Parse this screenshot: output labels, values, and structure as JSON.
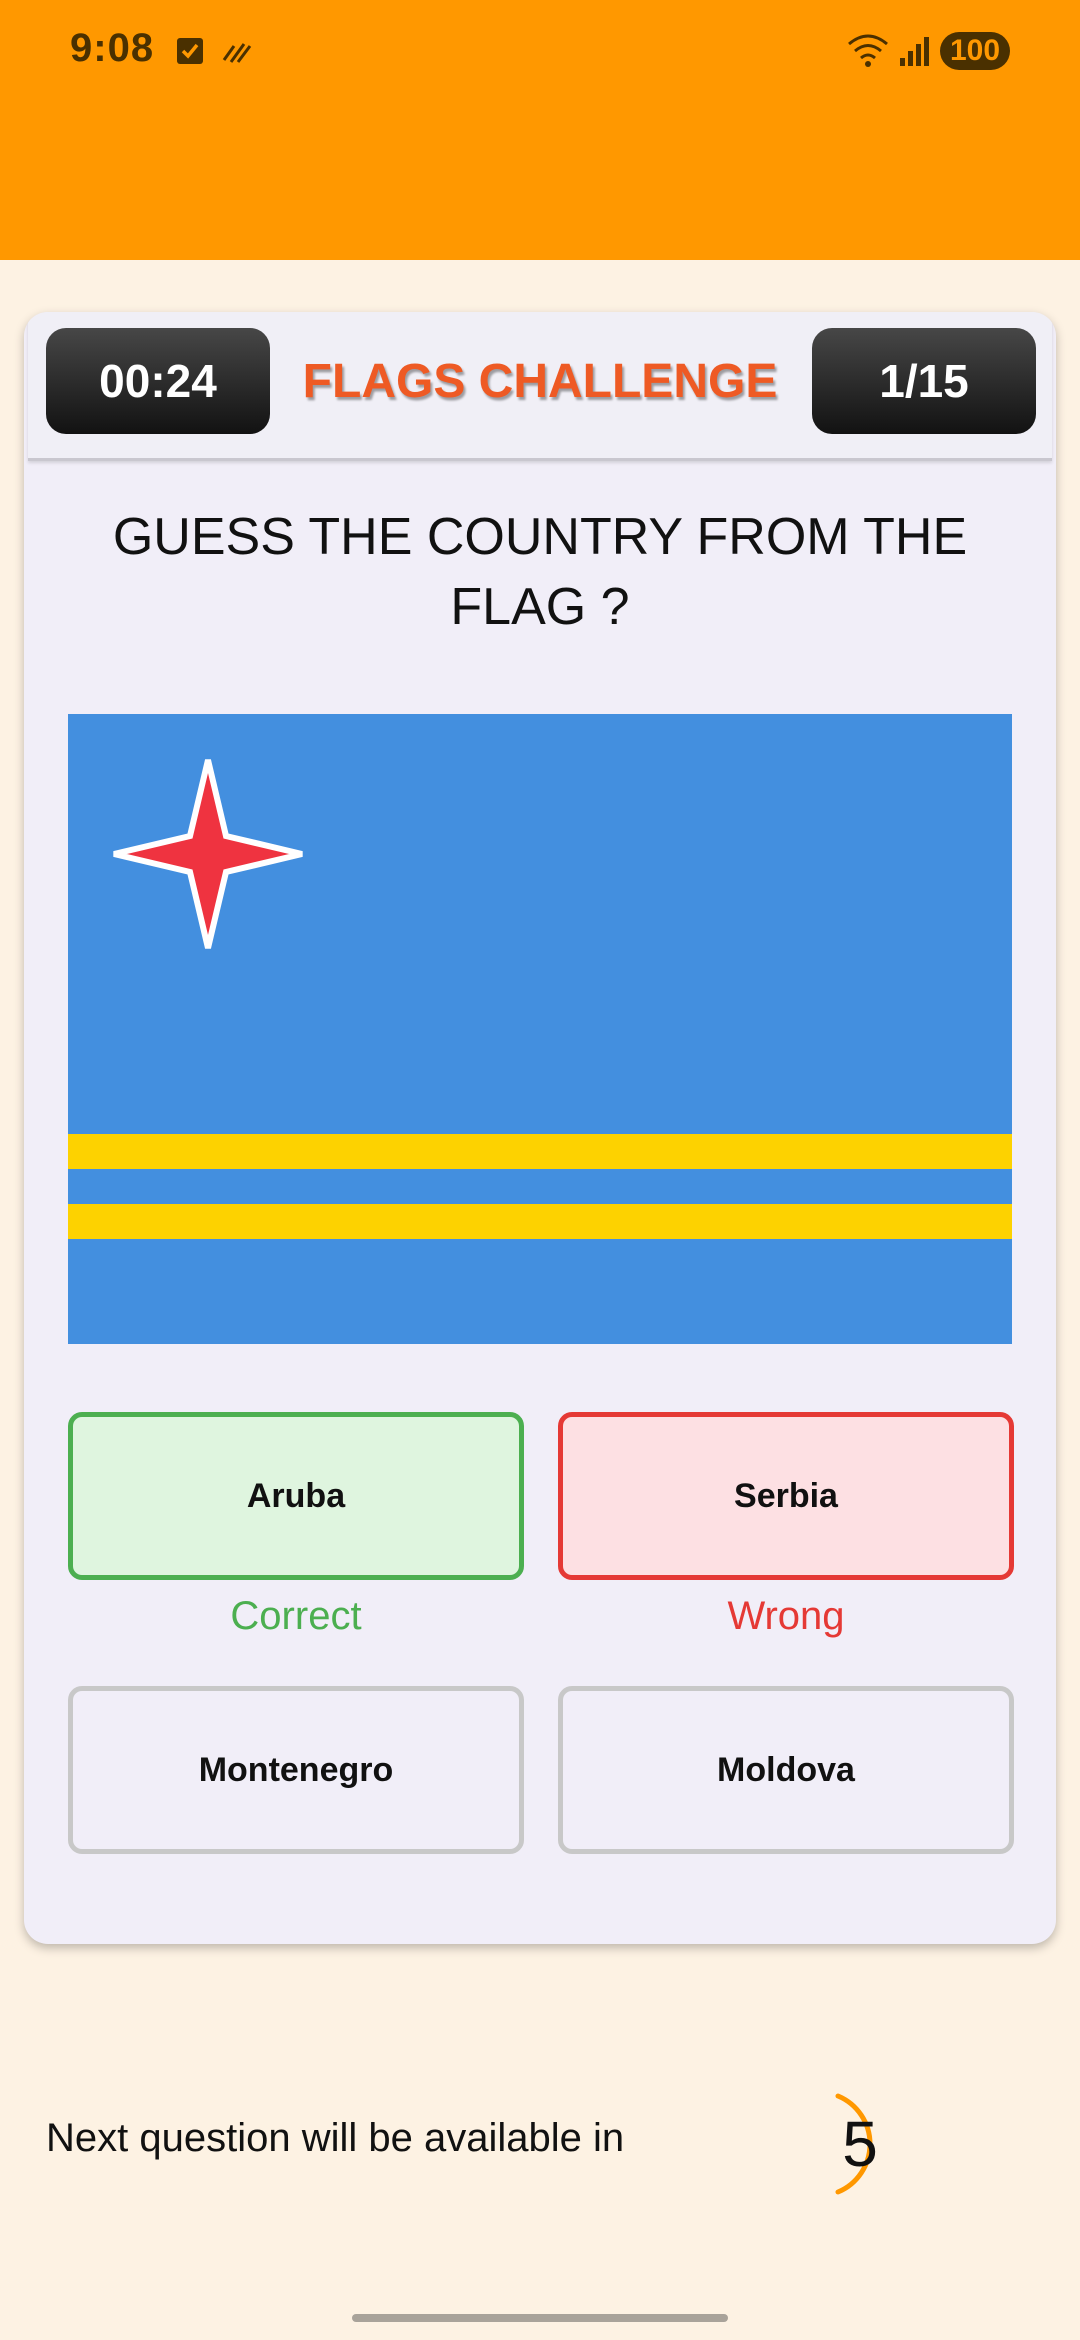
{
  "status_bar": {
    "time": "9:08",
    "battery": "100"
  },
  "header": {
    "timer": "00:24",
    "title": "FLAGS CHALLENGE",
    "progress": "1/15"
  },
  "question": "GUESS THE COUNTRY FROM THE FLAG ?",
  "flag": {
    "colors": {
      "field": "#438fdf",
      "stripe": "#fdd200",
      "star": "#ef3340",
      "star_outline": "#ffffff"
    }
  },
  "options": [
    {
      "label": "Aruba",
      "state": "correct"
    },
    {
      "label": "Serbia",
      "state": "wrong"
    },
    {
      "label": "Montenegro",
      "state": "neutral"
    },
    {
      "label": "Moldova",
      "state": "neutral"
    }
  ],
  "feedback": {
    "correct": "Correct",
    "wrong": "Wrong"
  },
  "next": {
    "text": "Next question will be available in",
    "countdown": "5"
  },
  "colors": {
    "accent": "#ff9800",
    "title": "#ee5a24",
    "correct": "#4caf50",
    "wrong": "#e53935",
    "background": "#fdf2e3",
    "card": "#f1eef8"
  },
  "icons": [
    "checkbox-icon",
    "no-sim-icon",
    "wifi-icon",
    "signal-icon",
    "battery-icon"
  ]
}
